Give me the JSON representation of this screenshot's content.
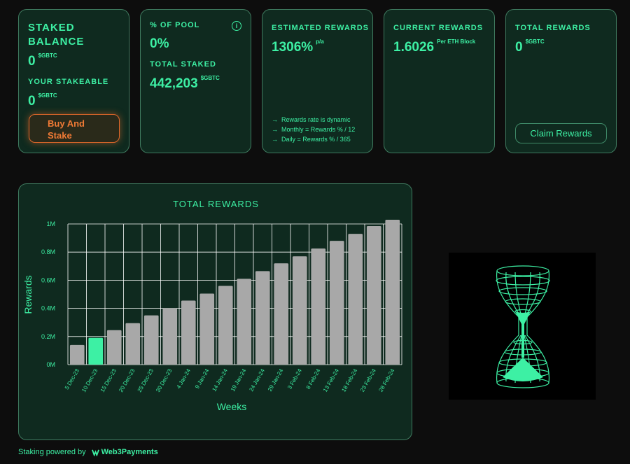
{
  "cards": {
    "staked": {
      "title_line1": "STAKED",
      "title_line2": "BALANCE",
      "value": "0",
      "unit": "$GBTC",
      "stakeable_label": "YOUR STAKEABLE",
      "stakeable_value": "0",
      "stakeable_unit": "$GBTC",
      "buy_line1": "Buy And",
      "buy_line2": "Stake"
    },
    "pool": {
      "title": "% OF POOL",
      "value": "0%",
      "total_label": "TOTAL STAKED",
      "total_value": "442,203",
      "total_unit": "$GBTC",
      "info_glyph": "i"
    },
    "estimated": {
      "title": "ESTIMATED REWARDS",
      "value": "1306%",
      "unit": "p/a",
      "notes": [
        "Rewards rate is dynamic",
        "Monthly = Rewards % / 12",
        "Daily = Rewards % / 365"
      ]
    },
    "current": {
      "title": "CURRENT REWARDS",
      "value": "1.6026",
      "unit": "Per ETH Block"
    },
    "total": {
      "title": "TOTAL REWARDS",
      "value": "0",
      "unit": "$GBTC",
      "claim_label": "Claim Rewards"
    }
  },
  "chart_data": {
    "type": "bar",
    "title": "TOTAL REWARDS",
    "xlabel": "Weeks",
    "ylabel": "Rewards",
    "ylim": [
      0,
      1000000
    ],
    "yticks": [
      {
        "value": 0,
        "label": "0M"
      },
      {
        "value": 200000,
        "label": "0.2M"
      },
      {
        "value": 400000,
        "label": "0.4M"
      },
      {
        "value": 600000,
        "label": "0.6M"
      },
      {
        "value": 800000,
        "label": "0.8M"
      },
      {
        "value": 1000000,
        "label": "1M"
      }
    ],
    "grid": true,
    "categories": [
      "5 Dec-23",
      "10 Dec-23",
      "15 Dec-23",
      "20 Dec-23",
      "25 Dec-23",
      "30 Dec-23",
      "4 Jan-24",
      "9 Jan-24",
      "14 Jan-24",
      "19 Jan-24",
      "24 Jan-24",
      "29 Jan-24",
      "3 Feb-24",
      "8 Feb-24",
      "13 Feb-24",
      "18 Feb-24",
      "23 Feb-24",
      "28 Feb-24"
    ],
    "values": [
      140000,
      190000,
      245000,
      295000,
      350000,
      400000,
      455000,
      505000,
      560000,
      610000,
      665000,
      720000,
      770000,
      825000,
      880000,
      930000,
      985000,
      1035000
    ],
    "highlight_index": 1,
    "colors": {
      "bar": "#a8a8a8",
      "highlight": "#3df0a4",
      "grid": "#ffffff",
      "axis_text": "#3df0a4"
    }
  },
  "footer": {
    "text": "Staking powered by",
    "brand": "Web3Payments"
  },
  "colors": {
    "accent": "#3df0a4",
    "card_bg": "#0f2a1f",
    "card_border": "#3f7a5f",
    "buy": "#f07a35",
    "page_bg": "#0d0d0d"
  }
}
